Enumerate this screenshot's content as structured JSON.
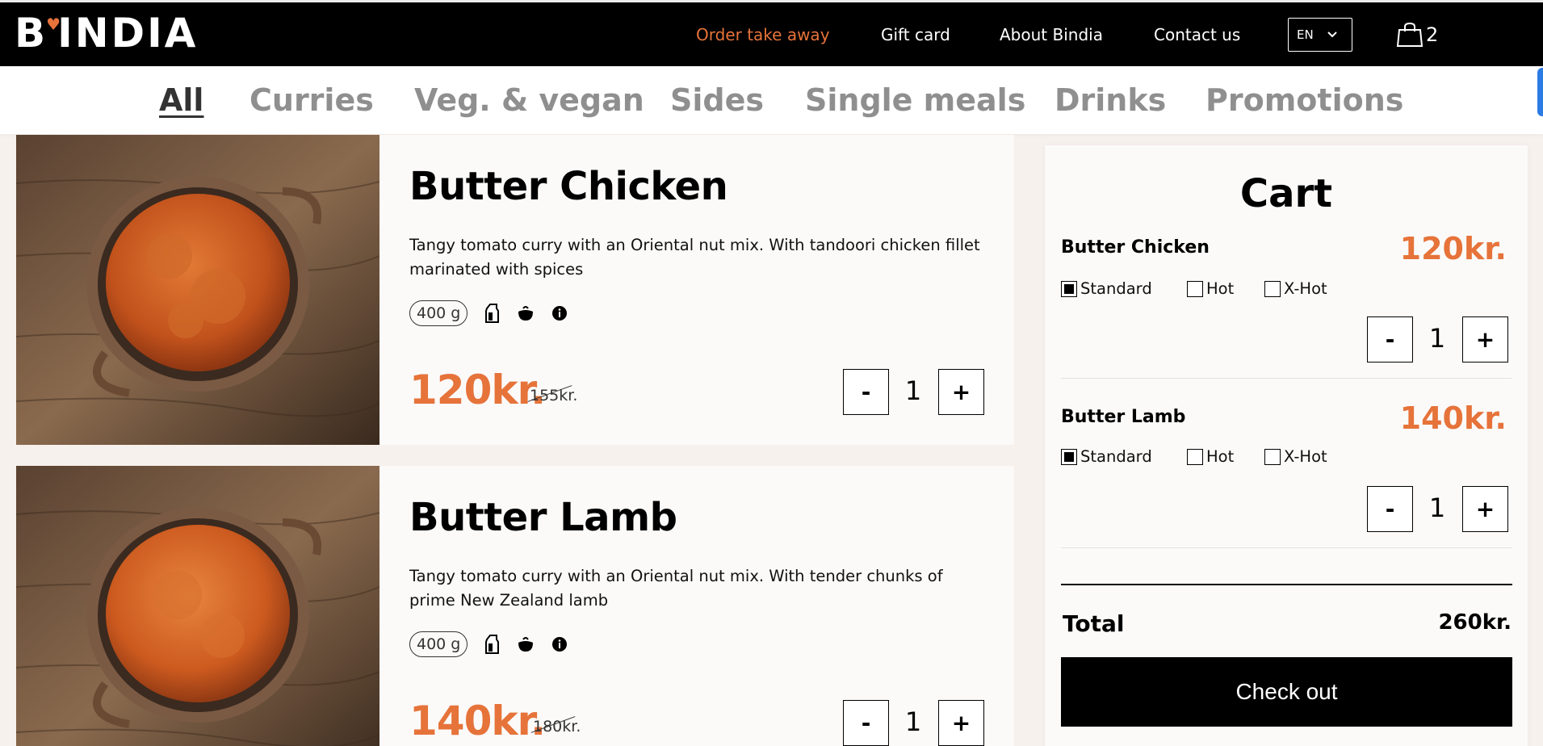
{
  "header": {
    "logo_text": "B'INDIA",
    "nav": [
      {
        "label": "Order take away",
        "active": true
      },
      {
        "label": "Gift card"
      },
      {
        "label": "About Bindia"
      },
      {
        "label": "Contact us"
      }
    ],
    "language": "EN",
    "cart_count": "2"
  },
  "categories": [
    {
      "label": "All",
      "active": true
    },
    {
      "label": "Curries"
    },
    {
      "label": "Veg. & vegan"
    },
    {
      "label": "Sides"
    },
    {
      "label": "Single meals"
    },
    {
      "label": "Drinks"
    },
    {
      "label": "Promotions"
    }
  ],
  "products": [
    {
      "name": "Butter Chicken",
      "description": "Tangy tomato curry with an Oriental nut mix. With tandoori chicken fillet marinated with spices",
      "weight": "400 g",
      "price": "120kr.",
      "old_price": "155kr.",
      "quantity": "1",
      "minus": "-",
      "plus": "+"
    },
    {
      "name": "Butter Lamb",
      "description": "Tangy tomato curry with an Oriental nut mix. With tender chunks of prime New Zealand lamb",
      "weight": "400 g",
      "price": "140kr.",
      "old_price": "180kr.",
      "quantity": "1",
      "minus": "-",
      "plus": "+"
    }
  ],
  "cart": {
    "title": "Cart",
    "items": [
      {
        "name": "Butter Chicken",
        "price": "120kr.",
        "options": [
          {
            "label": "Standard",
            "checked": true
          },
          {
            "label": "Hot",
            "checked": false
          },
          {
            "label": "X-Hot",
            "checked": false
          }
        ],
        "quantity": "1",
        "minus": "-",
        "plus": "+"
      },
      {
        "name": "Butter Lamb",
        "price": "140kr.",
        "options": [
          {
            "label": "Standard",
            "checked": true
          },
          {
            "label": "Hot",
            "checked": false
          },
          {
            "label": "X-Hot",
            "checked": false
          }
        ],
        "quantity": "1",
        "minus": "-",
        "plus": "+"
      }
    ],
    "total_label": "Total",
    "total_value": "260kr.",
    "checkout_label": "Check out"
  },
  "colors": {
    "accent": "#e6733a",
    "header_bg": "#000000",
    "category_inactive": "#8f8f8f"
  },
  "icons": [
    "bag-icon",
    "chevron-down-icon",
    "milk-carton-icon",
    "bowl-icon",
    "info-icon"
  ]
}
